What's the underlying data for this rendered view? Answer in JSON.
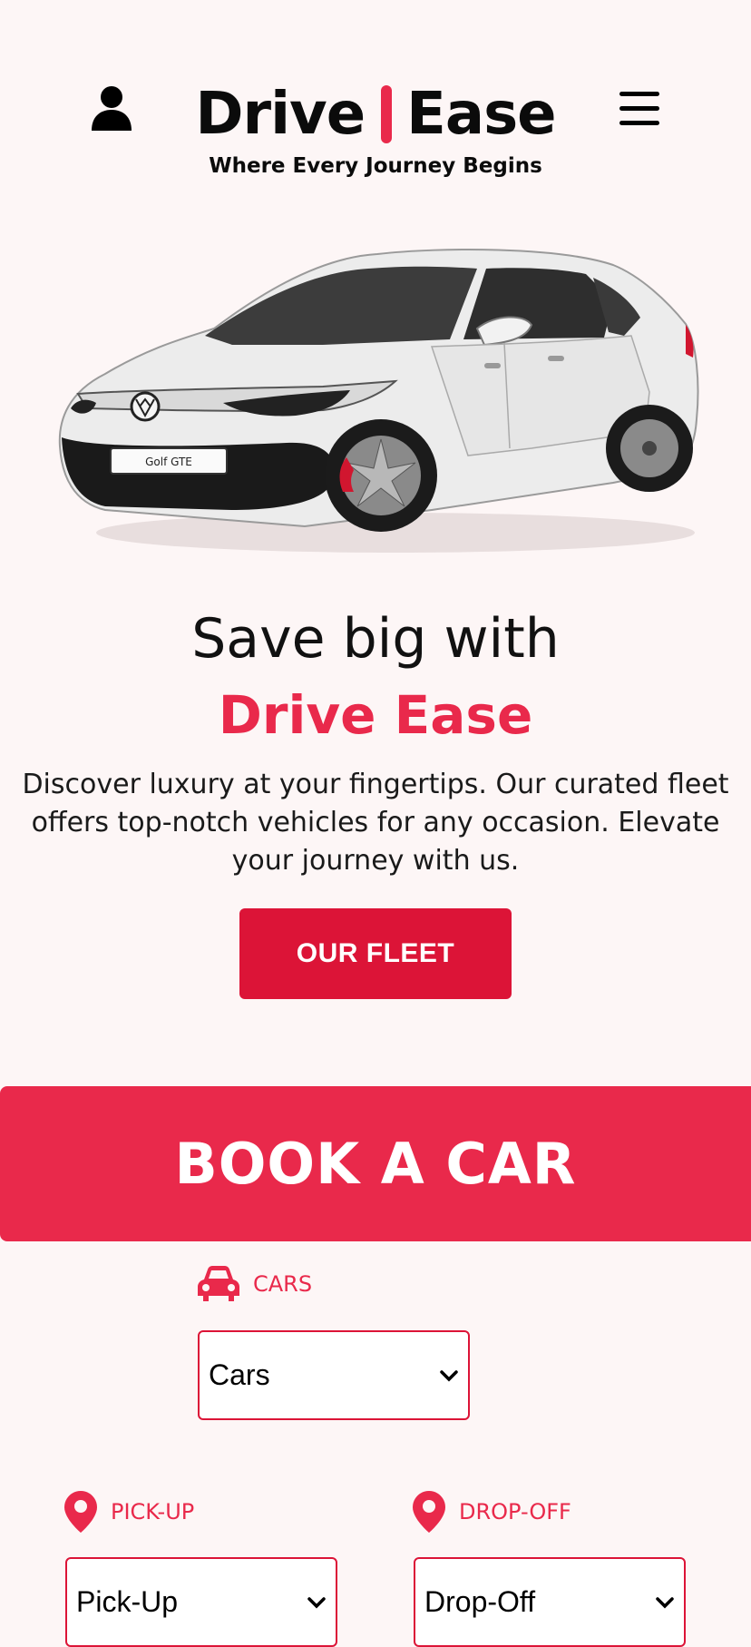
{
  "header": {
    "brand_left": "Drive",
    "brand_right": "Ease",
    "tagline": "Where Every Journey Begins",
    "user_icon": "user-icon",
    "menu_icon": "hamburger-menu-icon"
  },
  "hero": {
    "car_plate": "Golf GTE",
    "title": "Save big with",
    "brand": "Drive Ease",
    "description": "Discover luxury at your fingertips. Our curated fleet offers top-notch vehicles for any occasion. Elevate your journey with us.",
    "button_label": "OUR FLEET"
  },
  "booking": {
    "banner_title": "BOOK A CAR",
    "cars": {
      "label": "CARS",
      "icon": "car-icon",
      "selected": "Cars"
    },
    "pickup": {
      "label": "PICK-UP",
      "icon": "location-pin-icon",
      "selected": "Pick-Up"
    },
    "dropoff": {
      "label": "DROP-OFF",
      "icon": "location-pin-icon",
      "selected": "Drop-Off"
    }
  },
  "colors": {
    "accent": "#e9294b",
    "button": "#dc1437",
    "background": "#fdf6f6"
  }
}
